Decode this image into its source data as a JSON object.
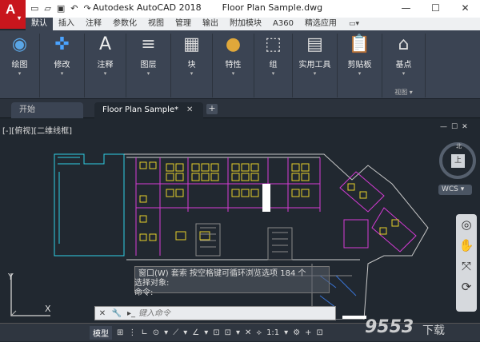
{
  "app": {
    "button_letter": "A",
    "name": "Autodesk AutoCAD 2018",
    "file": "Floor Plan Sample.dwg"
  },
  "window": {
    "minimize": "—",
    "maximize": "☐",
    "close": "✕"
  },
  "ribbon_tabs": [
    "默认",
    "插入",
    "注释",
    "参数化",
    "视图",
    "管理",
    "输出",
    "附加模块",
    "A360",
    "精选应用"
  ],
  "ribbon_tab_control": "▭▾",
  "tools": [
    {
      "label": "绘图",
      "icon": "draw-icon"
    },
    {
      "label": "修改",
      "icon": "modify-icon"
    },
    {
      "label": "注释",
      "icon": "annotation-icon"
    },
    {
      "label": "图层",
      "icon": "layers-icon"
    },
    {
      "label": "块",
      "icon": "block-icon"
    },
    {
      "label": "特性",
      "icon": "properties-icon"
    },
    {
      "label": "组",
      "icon": "group-icon"
    },
    {
      "label": "实用工具",
      "icon": "utilities-icon"
    },
    {
      "label": "剪贴板",
      "icon": "clipboard-icon"
    },
    {
      "label": "基点",
      "icon": "basepoint-icon",
      "sub": "视图 ▾"
    }
  ],
  "doc_tabs": [
    {
      "label": "开始",
      "active": false
    },
    {
      "label": "Floor Plan Sample*",
      "active": true
    }
  ],
  "new_tab": "+",
  "viewport": {
    "label": "[-][俯视][二维线框]",
    "controls": [
      "—",
      "☐",
      "✕"
    ]
  },
  "viewcube": {
    "face": "上",
    "north": "北",
    "wcs": "WCS ▾"
  },
  "tooltip": {
    "line1": "窗口(W)  套索  按空格键可循环浏览选项  184 个"
  },
  "cmd_history": [
    "选择对象:",
    "命令:"
  ],
  "cmdline": {
    "placeholder": "键入命令",
    "close": "✕",
    "wrench": "🔧",
    "prompt": "▸_"
  },
  "status": {
    "model": "模型",
    "items": [
      "⊞",
      "⋮",
      "∟",
      "⊙",
      "▾",
      "⟋",
      "▾",
      "∠",
      "▾",
      "⊡",
      "⊡",
      "▾",
      "✕",
      "⟡",
      "1:1",
      "▾",
      "⚙",
      "+",
      "⊡"
    ]
  },
  "ucs": {
    "x": "X",
    "y": "Y"
  },
  "watermark": "9553下载",
  "colors": {
    "accent": "#c8161d",
    "ribbon": "#3b4453",
    "canvas": "#212830"
  }
}
